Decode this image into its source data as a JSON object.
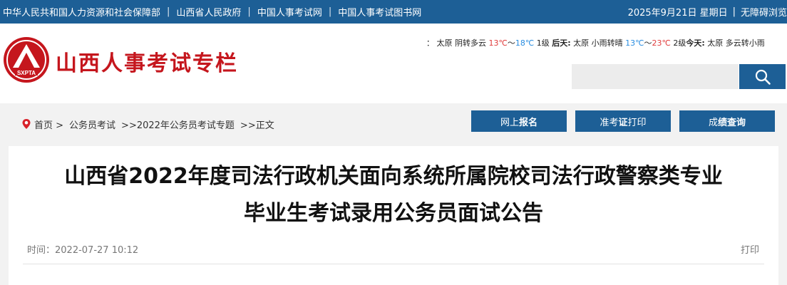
{
  "topbar": {
    "links": [
      "中华人民共和国人力资源和社会保障部",
      "山西省人民政府",
      "中国人事考试网",
      "中国人事考试图书网"
    ],
    "date": "2025年9月21日 星期日",
    "accessibility": "无障碍浏览"
  },
  "site": {
    "logo_text": "SXPTA",
    "title": "山西人事考试专栏"
  },
  "weather": {
    "prefix": "：",
    "today_city": "太原",
    "today_cond": "阴转多云",
    "today_low": "13℃",
    "today_tilde": "～",
    "today_high": "18℃",
    "today_wind": "1级",
    "tomorrow_label": "后天:",
    "tomorrow_city": "太原",
    "tomorrow_cond": "小雨转晴",
    "tomorrow_low": "13℃",
    "tomorrow_tilde": "～",
    "tomorrow_high": "23℃",
    "tomorrow_wind": "2级",
    "next_label": "今天:",
    "next_city": "太原",
    "next_cond": "多云转小雨"
  },
  "search": {
    "placeholder": ""
  },
  "breadcrumb": [
    "首页 >",
    "公务员考试",
    ">>2022年公务员考试专题",
    ">>正文"
  ],
  "nav_buttons": [
    {
      "pre": "网上",
      "bold": "报名",
      "post": ""
    },
    {
      "pre": "准考",
      "bold": "证",
      "post": "打印"
    },
    {
      "pre": "成",
      "bold": "绩查询",
      "post": ""
    }
  ],
  "article": {
    "title_line1": "山西省2022年度司法行政机关面向系统所属院校司法行政警察类专业",
    "title_line2": "毕业生考试录用公务员面试公告",
    "time_label": "时间：",
    "time_value": "2022-07-27 10:12",
    "print_label": "打印"
  },
  "colors": {
    "brand_blue": "#1d5f96",
    "brand_red": "#c5161d"
  }
}
